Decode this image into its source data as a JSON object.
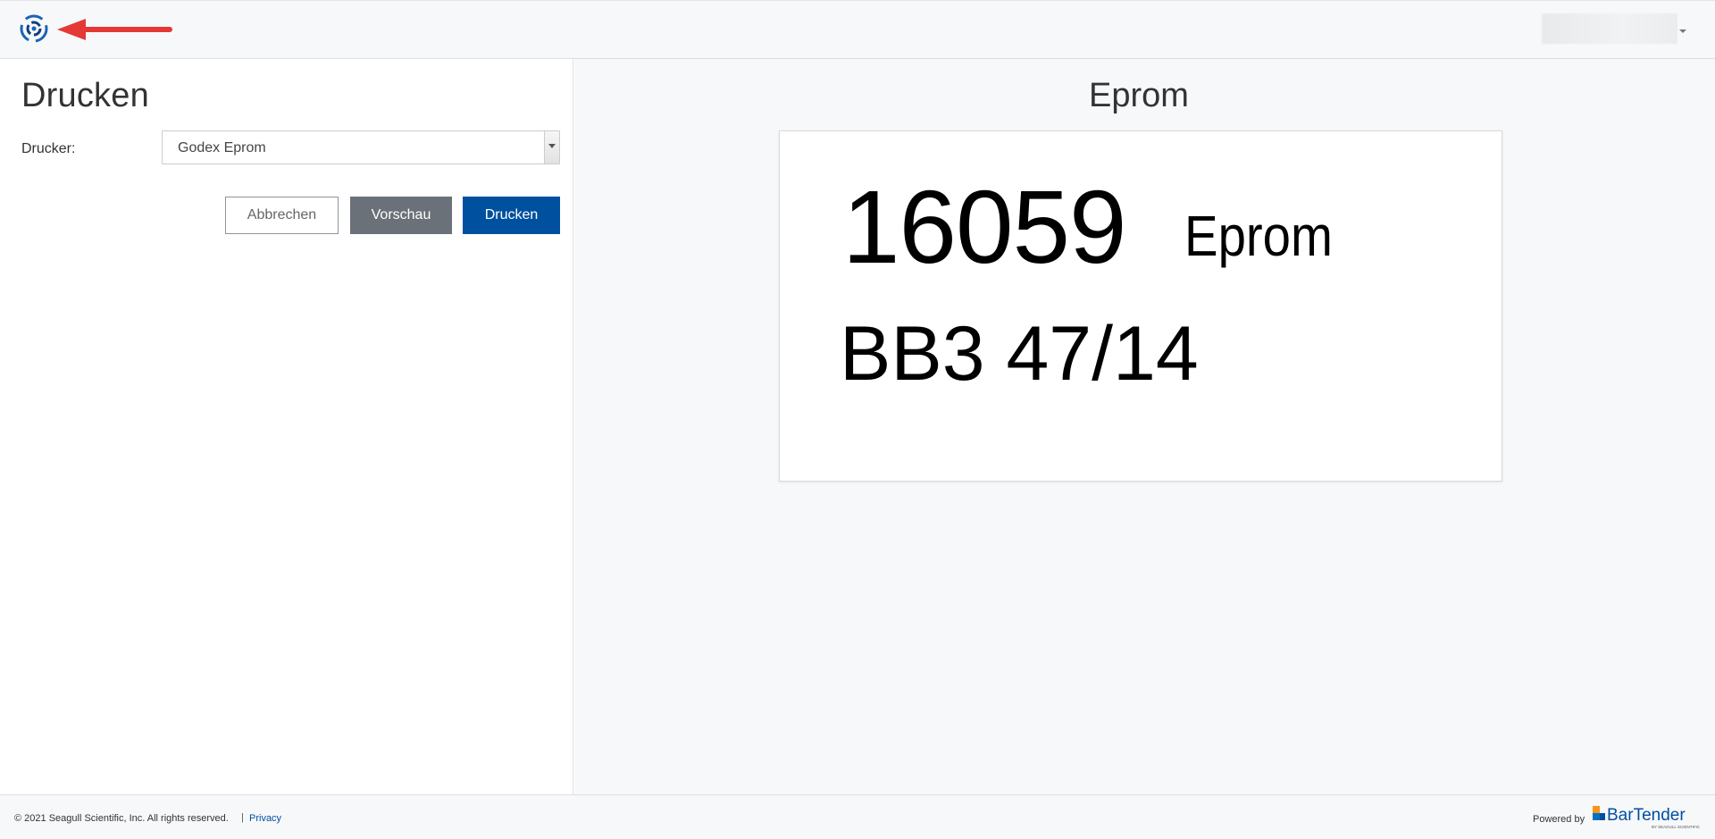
{
  "header": {
    "logo_icon": "seagull-logo-icon",
    "annotation_icon": "red-arrow-icon",
    "user_menu_icon": "caret-down-icon"
  },
  "print_panel": {
    "title": "Drucken",
    "printer_label": "Drucker:",
    "printer_value": "Godex Eprom",
    "buttons": {
      "cancel": "Abbrechen",
      "preview": "Vorschau",
      "print": "Drucken"
    }
  },
  "preview": {
    "title": "Eprom",
    "label": {
      "number": "16059",
      "type": "Eprom",
      "code": "BB3 47/14"
    }
  },
  "footer": {
    "copyright": "© 2021 Seagull Scientific, Inc. All rights reserved.",
    "separator": "|",
    "privacy": "Privacy",
    "powered_by": "Powered by",
    "brand_name": "BarTender",
    "brand_sub": "BY SEAGULL SCIENTIFIC"
  },
  "colors": {
    "primary": "#0050a0",
    "secondary": "#6b7178",
    "annotation": "#e53935"
  }
}
